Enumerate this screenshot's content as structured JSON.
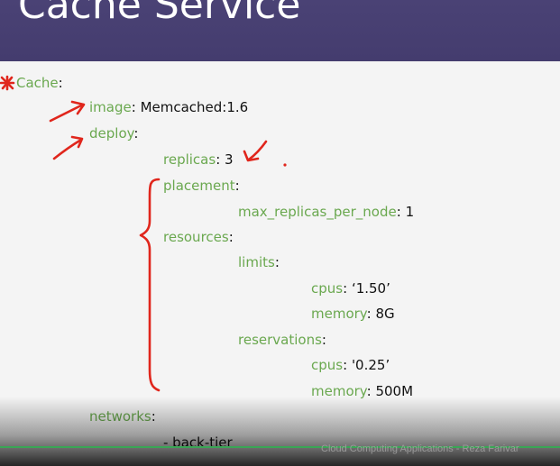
{
  "slide": {
    "title": "Cache Service",
    "footer": "Cloud Computing Applications - Reza Farivar"
  },
  "code": {
    "cache_key": "Cache",
    "image_key": "image",
    "image_value": "Memcached:1.6",
    "deploy_key": "deploy",
    "replicas_key": "replicas",
    "replicas_value": "3",
    "placement_key": "placement",
    "max_replicas_key": "max_replicas_per_node",
    "max_replicas_value": "1",
    "resources_key": "resources",
    "limits_key": "limits",
    "limits_cpus_key": "cpus",
    "limits_cpus_value": "‘1.50’",
    "limits_memory_key": "memory",
    "limits_memory_value": "8G",
    "reservations_key": "reservations",
    "reservations_cpus_key": "cpus",
    "reservations_cpus_value": "'0.25’",
    "reservations_memory_key": "memory",
    "reservations_memory_value": "500M",
    "networks_key": "networks",
    "networks_item": "- back-tier",
    "colon": ":"
  },
  "colors": {
    "title_bar": "#443c6e",
    "key_text": "#6aa84f",
    "annotation": "#e0261c"
  }
}
